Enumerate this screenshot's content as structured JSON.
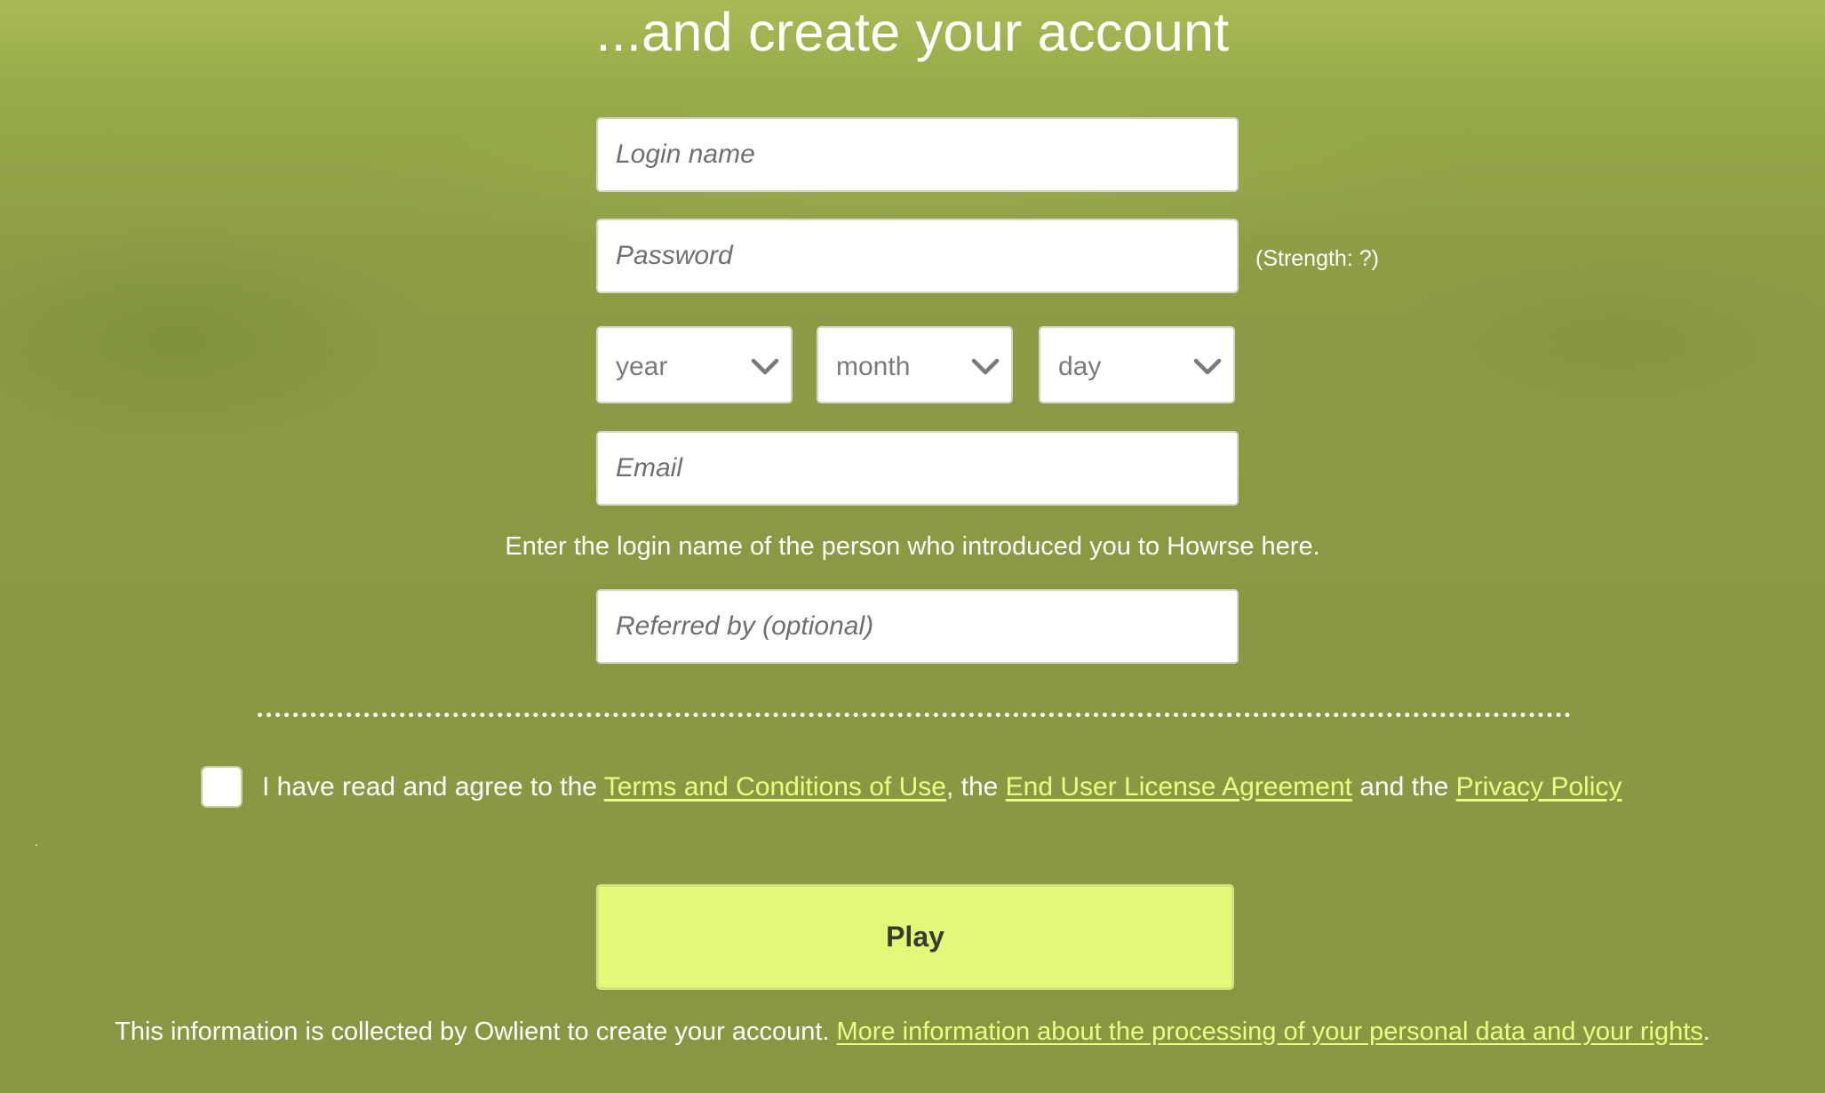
{
  "page": {
    "title": "...and create your account"
  },
  "form": {
    "login_placeholder": "Login name",
    "password_placeholder": "Password",
    "password_strength": "(Strength: ?)",
    "birthdate": {
      "year_label": "year",
      "month_label": "month",
      "day_label": "day"
    },
    "email_placeholder": "Email",
    "referral_hint": "Enter the login name of the person who introduced you to Howrse here.",
    "referrer_placeholder": "Referred by (optional)"
  },
  "terms": {
    "checked": false,
    "prefix": "I have read and agree to the ",
    "terms_link": "Terms and Conditions of Use",
    "sep1": ", the ",
    "eula_link": "End User License Agreement",
    "sep2": " and the ",
    "privacy_link": "Privacy Policy"
  },
  "submit": {
    "label": "Play"
  },
  "footer": {
    "text": "This information is collected by Owlient to create your account. ",
    "link": "More information about the processing of your personal data and your rights",
    "suffix": "."
  },
  "icons": {
    "dropdown": "chevron-down-icon"
  },
  "colors": {
    "background": "#8b9a43",
    "link": "#eaff82",
    "button": "#e2f978",
    "text": "#ffffff"
  }
}
